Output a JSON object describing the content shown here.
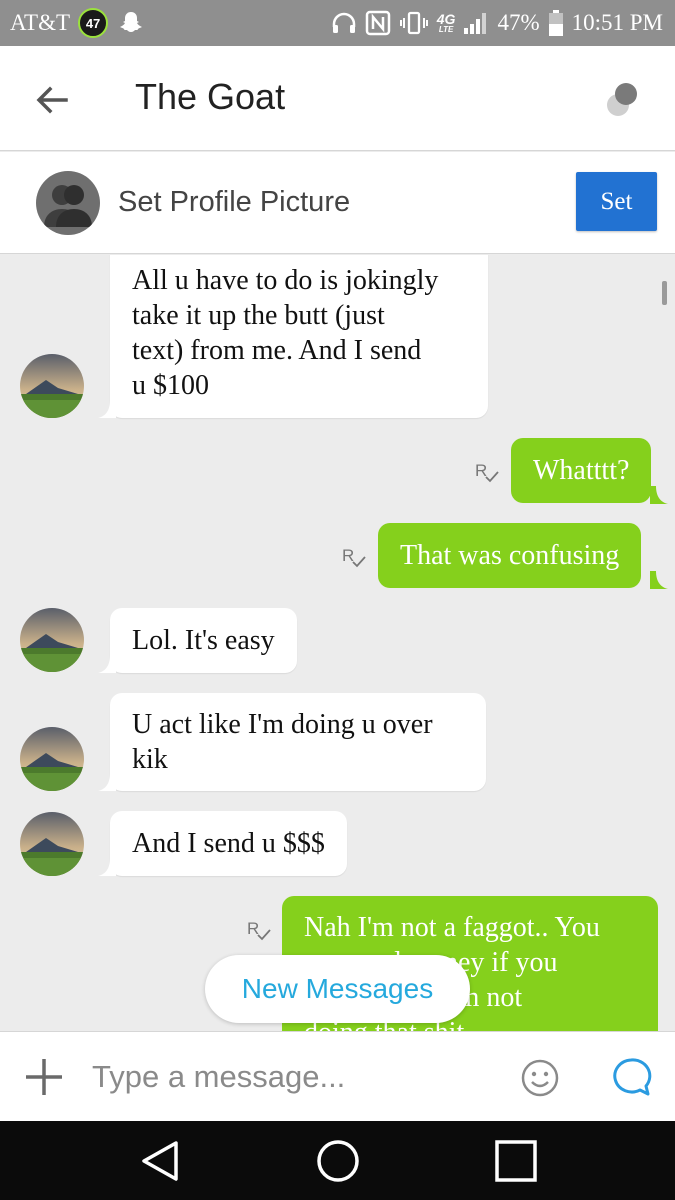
{
  "status_bar": {
    "carrier": "AT&T",
    "badge": "47",
    "network": "4G",
    "network_sub": "LTE",
    "battery": "47%",
    "time": "10:51 PM"
  },
  "header": {
    "title": "The Goat"
  },
  "profile_bar": {
    "label": "Set Profile Picture",
    "button": "Set"
  },
  "messages": [
    {
      "side": "in",
      "lines": [
        "All u have to do is jokingly",
        "take it up the butt (just",
        "text) from me. And I send",
        "u $100"
      ]
    },
    {
      "side": "out",
      "lines": [
        "Whatttt?"
      ],
      "receipt": "R"
    },
    {
      "side": "out",
      "lines": [
        "That was confusing"
      ],
      "receipt": "R"
    },
    {
      "side": "in",
      "lines": [
        "Lol. It's easy"
      ]
    },
    {
      "side": "in",
      "lines": [
        "U act like I'm doing u over",
        "kik"
      ]
    },
    {
      "side": "in",
      "lines": [
        "And I send u $$$"
      ]
    },
    {
      "side": "out",
      "lines": [
        "Nah I'm not a faggot.. You",
        "can send money if you",
        "want but no I'm not",
        "doing that shit"
      ],
      "receipt": "R"
    }
  ],
  "new_messages_label": "New Messages",
  "composer": {
    "placeholder": "Type a message..."
  },
  "colors": {
    "outgoing_bubble": "#85d01c",
    "incoming_bubble": "#ffffff",
    "set_button": "#2272d2",
    "accent_link": "#25a9dd"
  },
  "icons": [
    "back-arrow-icon",
    "options-icon",
    "profile-silhouette-icon",
    "read-receipt-icon",
    "plus-icon",
    "smiley-icon",
    "chat-bubble-icon",
    "nav-back-icon",
    "nav-home-icon",
    "nav-recents-icon"
  ]
}
